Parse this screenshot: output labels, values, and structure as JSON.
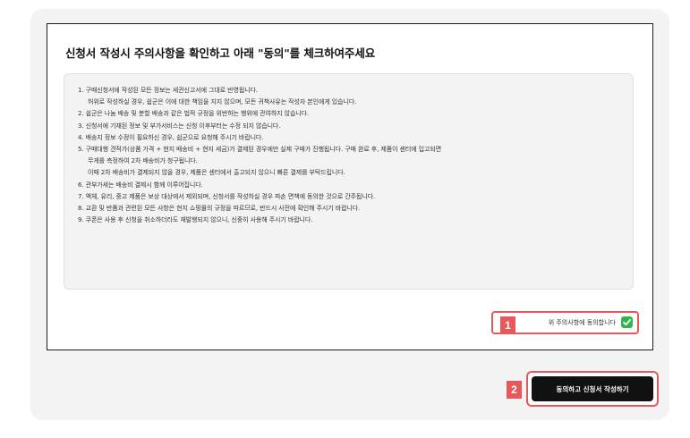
{
  "title": "신청서 작성시 주의사항을 확인하고 아래 \"동의\"를 체크하여주세요",
  "notices": [
    [
      "1. 구매신청서에 작성된 모든 정보는 세관신고서에 그대로 반영됩니다.",
      "허위로 작성하실 경우, 쉽군은 이에 대한 책임을 지지 않으며, 모든 귀책사유는 작성자 본인에게 있습니다."
    ],
    [
      "2. 쉽군은 나눔 배송 및 분할 배송과 같은 법적 규정을 위반하는 행위에 관여하지 않습니다."
    ],
    [
      "3. 신청서에 기재된 정보 및 부가서비스는 신청 이후부터는 수정 되지 않습니다."
    ],
    [
      "4. 배송지 정보 수정이 필요하신 경우, 쉽군으로 요청해 주시기 바랍니다."
    ],
    [
      "5. 구매대행 견적가(상품 가격 + 현지 배송비 + 현지 세금)가 결제된 경우에만 실제 구매가 진행됩니다. 구매 완료 후, 제품이 센터에 입고되면",
      "무게를 측정하여 2차 배송비가 청구됩니다.",
      "이때 2차 배송비가 결제되지 않을 경우, 제품은 센터에서 출고되지 않으니 빠른 결제를 부탁드립니다."
    ],
    [
      "6. 관부가세는 배송비 결제시 함께 이루어집니다."
    ],
    [
      "7. 액체, 유리, 중고 제품은 보상 대상에서 제외되며, 신청서를 작성하실 경우 파손 면책에 동의한 것으로 간주됩니다."
    ],
    [
      "8. 교환 및 반품과 관련된 모든 사항은 현지 쇼핑몰의 규정을 따르므로, 반드시 사전에 확인해 주시기 바랍니다."
    ],
    [
      "9. 쿠폰은 사용 후 신청을 취소하더라도 재발행되지 않으니, 신중히 사용해 주시기 바랍니다."
    ]
  ],
  "agree": {
    "label": "위 주의사항에 동의합니다",
    "checked": true,
    "icon": "check-icon",
    "check_color": "#2fb44d"
  },
  "badges": {
    "one": "1",
    "two": "2",
    "color": "#e8585b"
  },
  "submit": {
    "label": "동의하고 신청서 작성하기"
  }
}
